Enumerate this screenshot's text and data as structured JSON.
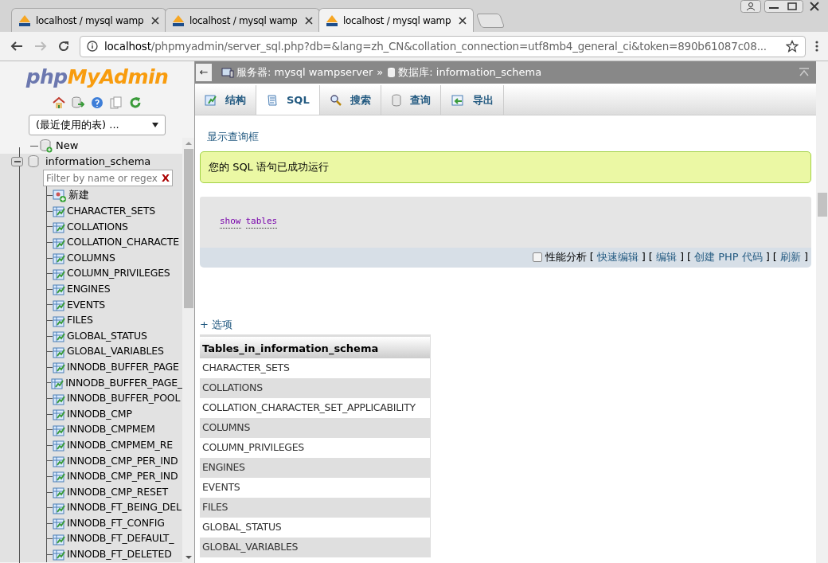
{
  "browser": {
    "tabs": [
      {
        "title": "localhost / mysql wamp",
        "selected": false
      },
      {
        "title": "localhost / mysql wamp",
        "selected": false
      },
      {
        "title": "localhost / mysql wamp",
        "selected": true
      }
    ],
    "address": {
      "host": "localhost",
      "path": "/phpmyadmin/server_sql.php?db=&lang=zh_CN&collation_connection=utf8mb4_general_ci&token=890b61087c08..."
    }
  },
  "navigation": {
    "logo": {
      "php": "php",
      "myadmin": "MyAdmin"
    },
    "recent_tables": "(最近使用的表) ...",
    "tree": [
      {
        "label": "New",
        "kind": "new"
      },
      {
        "label": "information_schema",
        "kind": "database",
        "expanded": true,
        "filter_placeholder": "Filter by name or regex",
        "clear": "X",
        "children": [
          {
            "label": "新建",
            "kind": "new"
          },
          {
            "label": "CHARACTER_SETS",
            "kind": "table"
          },
          {
            "label": "COLLATIONS",
            "kind": "table"
          },
          {
            "label": "COLLATION_CHARACTE",
            "kind": "table"
          },
          {
            "label": "COLUMNS",
            "kind": "table"
          },
          {
            "label": "COLUMN_PRIVILEGES",
            "kind": "table"
          },
          {
            "label": "ENGINES",
            "kind": "table"
          },
          {
            "label": "EVENTS",
            "kind": "table"
          },
          {
            "label": "FILES",
            "kind": "table"
          },
          {
            "label": "GLOBAL_STATUS",
            "kind": "table"
          },
          {
            "label": "GLOBAL_VARIABLES",
            "kind": "table"
          },
          {
            "label": "INNODB_BUFFER_PAGE",
            "kind": "table"
          },
          {
            "label": "INNODB_BUFFER_PAGE_",
            "kind": "table"
          },
          {
            "label": "INNODB_BUFFER_POOL",
            "kind": "table"
          },
          {
            "label": "INNODB_CMP",
            "kind": "table"
          },
          {
            "label": "INNODB_CMPMEM",
            "kind": "table"
          },
          {
            "label": "INNODB_CMPMEM_RE",
            "kind": "table"
          },
          {
            "label": "INNODB_CMP_PER_IND",
            "kind": "table"
          },
          {
            "label": "INNODB_CMP_PER_IND",
            "kind": "table"
          },
          {
            "label": "INNODB_CMP_RESET",
            "kind": "table"
          },
          {
            "label": "INNODB_FT_BEING_DEL",
            "kind": "table"
          },
          {
            "label": "INNODB_FT_CONFIG",
            "kind": "table"
          },
          {
            "label": "INNODB_FT_DEFAULT_",
            "kind": "table"
          },
          {
            "label": "INNODB_FT_DELETED",
            "kind": "table"
          }
        ]
      }
    ]
  },
  "breadcrumb": {
    "back": "←",
    "separator": "»",
    "items": [
      {
        "label": "服务器: mysql wampserver",
        "kind": "server"
      },
      {
        "label": "数据库: information_schema",
        "kind": "database"
      }
    ]
  },
  "tabs": [
    {
      "label": "结构",
      "kind": "structure",
      "selected": false
    },
    {
      "label": "SQL",
      "kind": "sql",
      "selected": true
    },
    {
      "label": "搜索",
      "kind": "search",
      "selected": false
    },
    {
      "label": "查询",
      "kind": "query",
      "selected": false
    },
    {
      "label": "导出",
      "kind": "export",
      "selected": false
    }
  ],
  "show_query_box": "显示查询框",
  "success_message": "您的 SQL 语句已成功运行",
  "query": {
    "keywords": [
      "show",
      "tables"
    ]
  },
  "query_actions": {
    "profiling": {
      "label": "性能分析",
      "checked": false
    },
    "links": [
      {
        "before": "[",
        "label": "快速编辑",
        "after": "]"
      },
      {
        "before": "[",
        "label": "编辑",
        "after": "]"
      },
      {
        "before": "[",
        "label": "创建 PHP 代码",
        "after": "]"
      },
      {
        "before": "[",
        "label": "刷新",
        "after": "]"
      }
    ]
  },
  "options_link": "+ 选项",
  "results": {
    "columns": [
      "Tables_in_information_schema"
    ],
    "rows": [
      "CHARACTER_SETS",
      "COLLATIONS",
      "COLLATION_CHARACTER_SET_APPLICABILITY",
      "COLUMNS",
      "COLUMN_PRIVILEGES",
      "ENGINES",
      "EVENTS",
      "FILES",
      "GLOBAL_STATUS",
      "GLOBAL_VARIABLES"
    ]
  }
}
